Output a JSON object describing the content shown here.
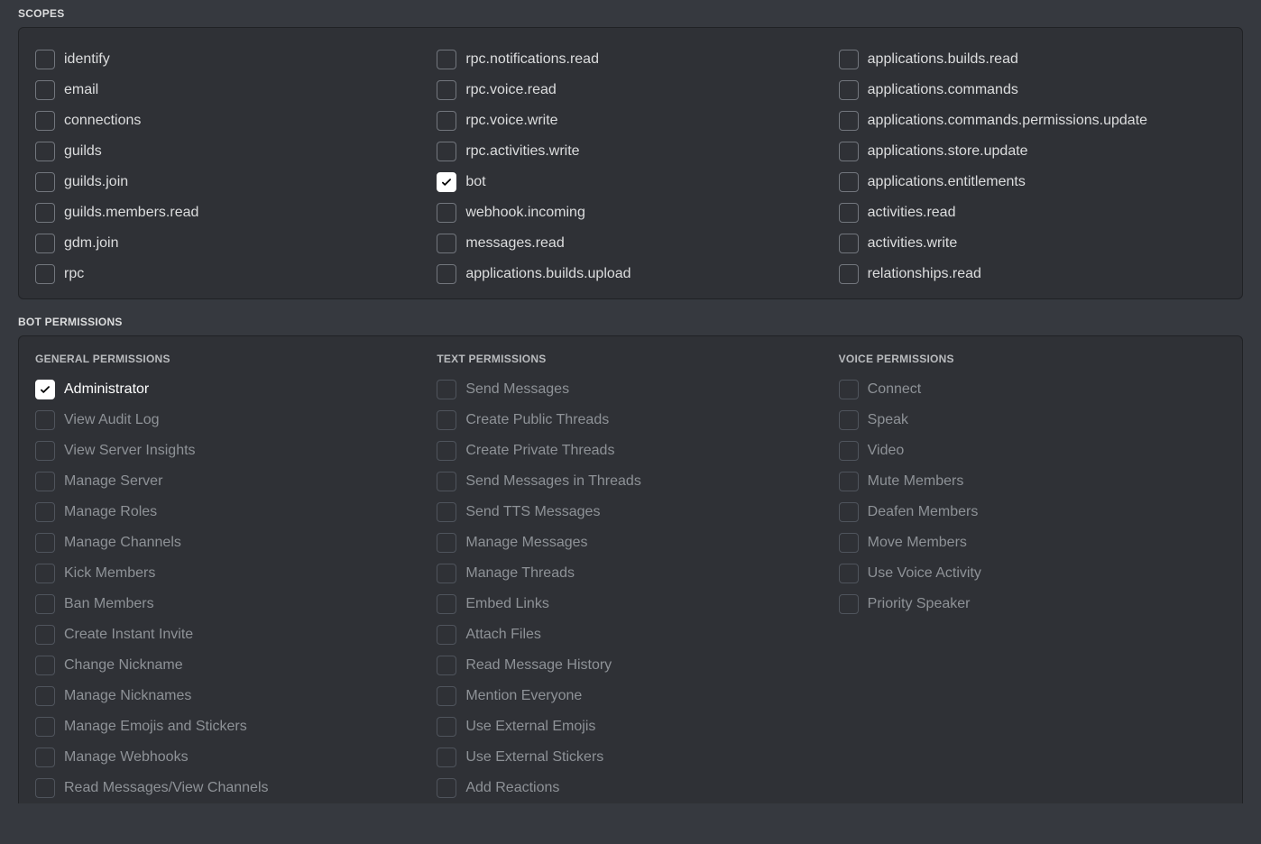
{
  "scopes": {
    "title": "SCOPES",
    "columns": [
      [
        {
          "label": "identify",
          "checked": false
        },
        {
          "label": "email",
          "checked": false
        },
        {
          "label": "connections",
          "checked": false
        },
        {
          "label": "guilds",
          "checked": false
        },
        {
          "label": "guilds.join",
          "checked": false
        },
        {
          "label": "guilds.members.read",
          "checked": false
        },
        {
          "label": "gdm.join",
          "checked": false
        },
        {
          "label": "rpc",
          "checked": false
        }
      ],
      [
        {
          "label": "rpc.notifications.read",
          "checked": false
        },
        {
          "label": "rpc.voice.read",
          "checked": false
        },
        {
          "label": "rpc.voice.write",
          "checked": false
        },
        {
          "label": "rpc.activities.write",
          "checked": false
        },
        {
          "label": "bot",
          "checked": true
        },
        {
          "label": "webhook.incoming",
          "checked": false
        },
        {
          "label": "messages.read",
          "checked": false
        },
        {
          "label": "applications.builds.upload",
          "checked": false
        }
      ],
      [
        {
          "label": "applications.builds.read",
          "checked": false
        },
        {
          "label": "applications.commands",
          "checked": false
        },
        {
          "label": "applications.commands.permissions.update",
          "checked": false
        },
        {
          "label": "applications.store.update",
          "checked": false
        },
        {
          "label": "applications.entitlements",
          "checked": false
        },
        {
          "label": "activities.read",
          "checked": false
        },
        {
          "label": "activities.write",
          "checked": false
        },
        {
          "label": "relationships.read",
          "checked": false
        }
      ]
    ]
  },
  "bot_permissions": {
    "title": "BOT PERMISSIONS",
    "columns": [
      {
        "title": "GENERAL PERMISSIONS",
        "items": [
          {
            "label": "Administrator",
            "checked": true,
            "disabled": false
          },
          {
            "label": "View Audit Log",
            "checked": false,
            "disabled": true
          },
          {
            "label": "View Server Insights",
            "checked": false,
            "disabled": true
          },
          {
            "label": "Manage Server",
            "checked": false,
            "disabled": true
          },
          {
            "label": "Manage Roles",
            "checked": false,
            "disabled": true
          },
          {
            "label": "Manage Channels",
            "checked": false,
            "disabled": true
          },
          {
            "label": "Kick Members",
            "checked": false,
            "disabled": true
          },
          {
            "label": "Ban Members",
            "checked": false,
            "disabled": true
          },
          {
            "label": "Create Instant Invite",
            "checked": false,
            "disabled": true
          },
          {
            "label": "Change Nickname",
            "checked": false,
            "disabled": true
          },
          {
            "label": "Manage Nicknames",
            "checked": false,
            "disabled": true
          },
          {
            "label": "Manage Emojis and Stickers",
            "checked": false,
            "disabled": true
          },
          {
            "label": "Manage Webhooks",
            "checked": false,
            "disabled": true
          },
          {
            "label": "Read Messages/View Channels",
            "checked": false,
            "disabled": true
          }
        ]
      },
      {
        "title": "TEXT PERMISSIONS",
        "items": [
          {
            "label": "Send Messages",
            "checked": false,
            "disabled": true
          },
          {
            "label": "Create Public Threads",
            "checked": false,
            "disabled": true
          },
          {
            "label": "Create Private Threads",
            "checked": false,
            "disabled": true
          },
          {
            "label": "Send Messages in Threads",
            "checked": false,
            "disabled": true
          },
          {
            "label": "Send TTS Messages",
            "checked": false,
            "disabled": true
          },
          {
            "label": "Manage Messages",
            "checked": false,
            "disabled": true
          },
          {
            "label": "Manage Threads",
            "checked": false,
            "disabled": true
          },
          {
            "label": "Embed Links",
            "checked": false,
            "disabled": true
          },
          {
            "label": "Attach Files",
            "checked": false,
            "disabled": true
          },
          {
            "label": "Read Message History",
            "checked": false,
            "disabled": true
          },
          {
            "label": "Mention Everyone",
            "checked": false,
            "disabled": true
          },
          {
            "label": "Use External Emojis",
            "checked": false,
            "disabled": true
          },
          {
            "label": "Use External Stickers",
            "checked": false,
            "disabled": true
          },
          {
            "label": "Add Reactions",
            "checked": false,
            "disabled": true
          }
        ]
      },
      {
        "title": "VOICE PERMISSIONS",
        "items": [
          {
            "label": "Connect",
            "checked": false,
            "disabled": true
          },
          {
            "label": "Speak",
            "checked": false,
            "disabled": true
          },
          {
            "label": "Video",
            "checked": false,
            "disabled": true
          },
          {
            "label": "Mute Members",
            "checked": false,
            "disabled": true
          },
          {
            "label": "Deafen Members",
            "checked": false,
            "disabled": true
          },
          {
            "label": "Move Members",
            "checked": false,
            "disabled": true
          },
          {
            "label": "Use Voice Activity",
            "checked": false,
            "disabled": true
          },
          {
            "label": "Priority Speaker",
            "checked": false,
            "disabled": true
          }
        ]
      }
    ]
  }
}
